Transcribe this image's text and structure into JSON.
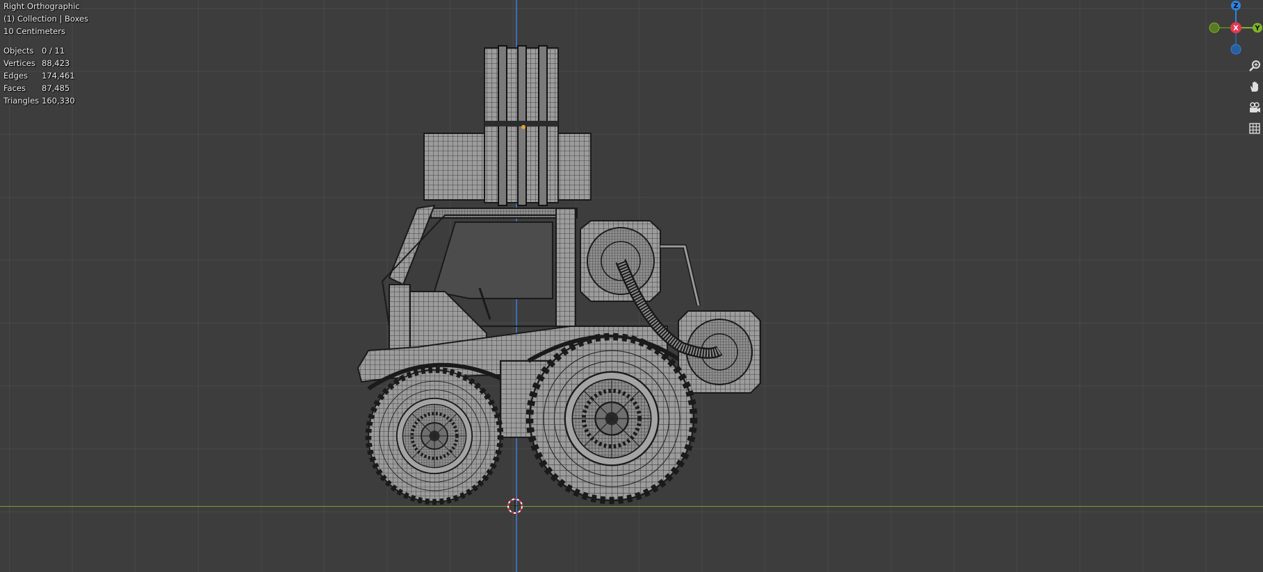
{
  "viewport": {
    "view_name": "Right Orthographic",
    "collection": "(1) Collection | Boxes",
    "units": "10 Centimeters",
    "stats": [
      {
        "label": "Objects",
        "value": "0 / 11"
      },
      {
        "label": "Vertices",
        "value": "88,423"
      },
      {
        "label": "Edges",
        "value": "174,461"
      },
      {
        "label": "Faces",
        "value": "87,485"
      },
      {
        "label": "Triangles",
        "value": "160,330"
      }
    ]
  },
  "gizmo": {
    "z_label": "Z",
    "x_label": "X",
    "y_label": "Y",
    "colors": {
      "z": "#2f83e2",
      "x": "#e8364f",
      "y": "#7fb32a",
      "z_neg": "#2a5f9e",
      "y_neg": "#587a24"
    }
  },
  "nav_controls": [
    {
      "name": "zoom-icon"
    },
    {
      "name": "hand-pan-icon"
    },
    {
      "name": "camera-icon"
    },
    {
      "name": "grid-icon"
    }
  ],
  "colors": {
    "background": "#3d3d3d",
    "mesh_fill": "#9a9a9a",
    "wire": "#1a1a1a",
    "axis_z": "#3d6fb4",
    "axis_y": "#7aa12f"
  }
}
